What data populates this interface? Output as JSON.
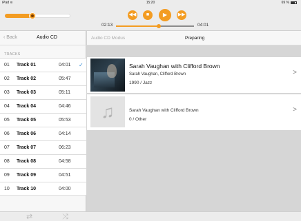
{
  "status_bar": {
    "device": "iPad",
    "wifi": "≋",
    "time": "15:20",
    "battery_text": "69 %"
  },
  "player": {
    "elapsed": "02:13",
    "total": "04:01",
    "progress": 0.55,
    "volume": 0.42,
    "controls": {
      "prev": "◀◀",
      "stop": "■",
      "play": "▶",
      "next": "▶▶"
    },
    "accent": "#f39c22"
  },
  "sidebar": {
    "back_label": "Back",
    "title": "Audio CD",
    "section_label": "TRACKS",
    "tracks": [
      {
        "num": "01",
        "name": "Track 01",
        "duration": "04:01",
        "selected": true
      },
      {
        "num": "02",
        "name": "Track 02",
        "duration": "05:47"
      },
      {
        "num": "03",
        "name": "Track 03",
        "duration": "05:11"
      },
      {
        "num": "04",
        "name": "Track 04",
        "duration": "04:46"
      },
      {
        "num": "05",
        "name": "Track 05",
        "duration": "05:53"
      },
      {
        "num": "06",
        "name": "Track 06",
        "duration": "04:14"
      },
      {
        "num": "07",
        "name": "Track 07",
        "duration": "06:23"
      },
      {
        "num": "08",
        "name": "Track 08",
        "duration": "04:58"
      },
      {
        "num": "09",
        "name": "Track 09",
        "duration": "04:51"
      },
      {
        "num": "10",
        "name": "Track 10",
        "duration": "04:00"
      }
    ],
    "check": "✓"
  },
  "main": {
    "mode_label": "Audio CD Modus",
    "state_label": "Preparing",
    "albums": [
      {
        "title": "Sarah Vaughan with Clifford Brown",
        "artist": "Sarah Vaughan, Clifford Brown",
        "meta": "1990  /  Jazz",
        "cover": "album-cover-photo"
      },
      {
        "title": "",
        "artist": "Sarah Vaughan with Clifford Brown",
        "meta": "0  /  Other",
        "cover": "music-note-icon"
      }
    ],
    "chevron": ">"
  },
  "bottom_bar": {
    "repeat_icon": "⇄",
    "shuffle_icon": "⤨"
  }
}
